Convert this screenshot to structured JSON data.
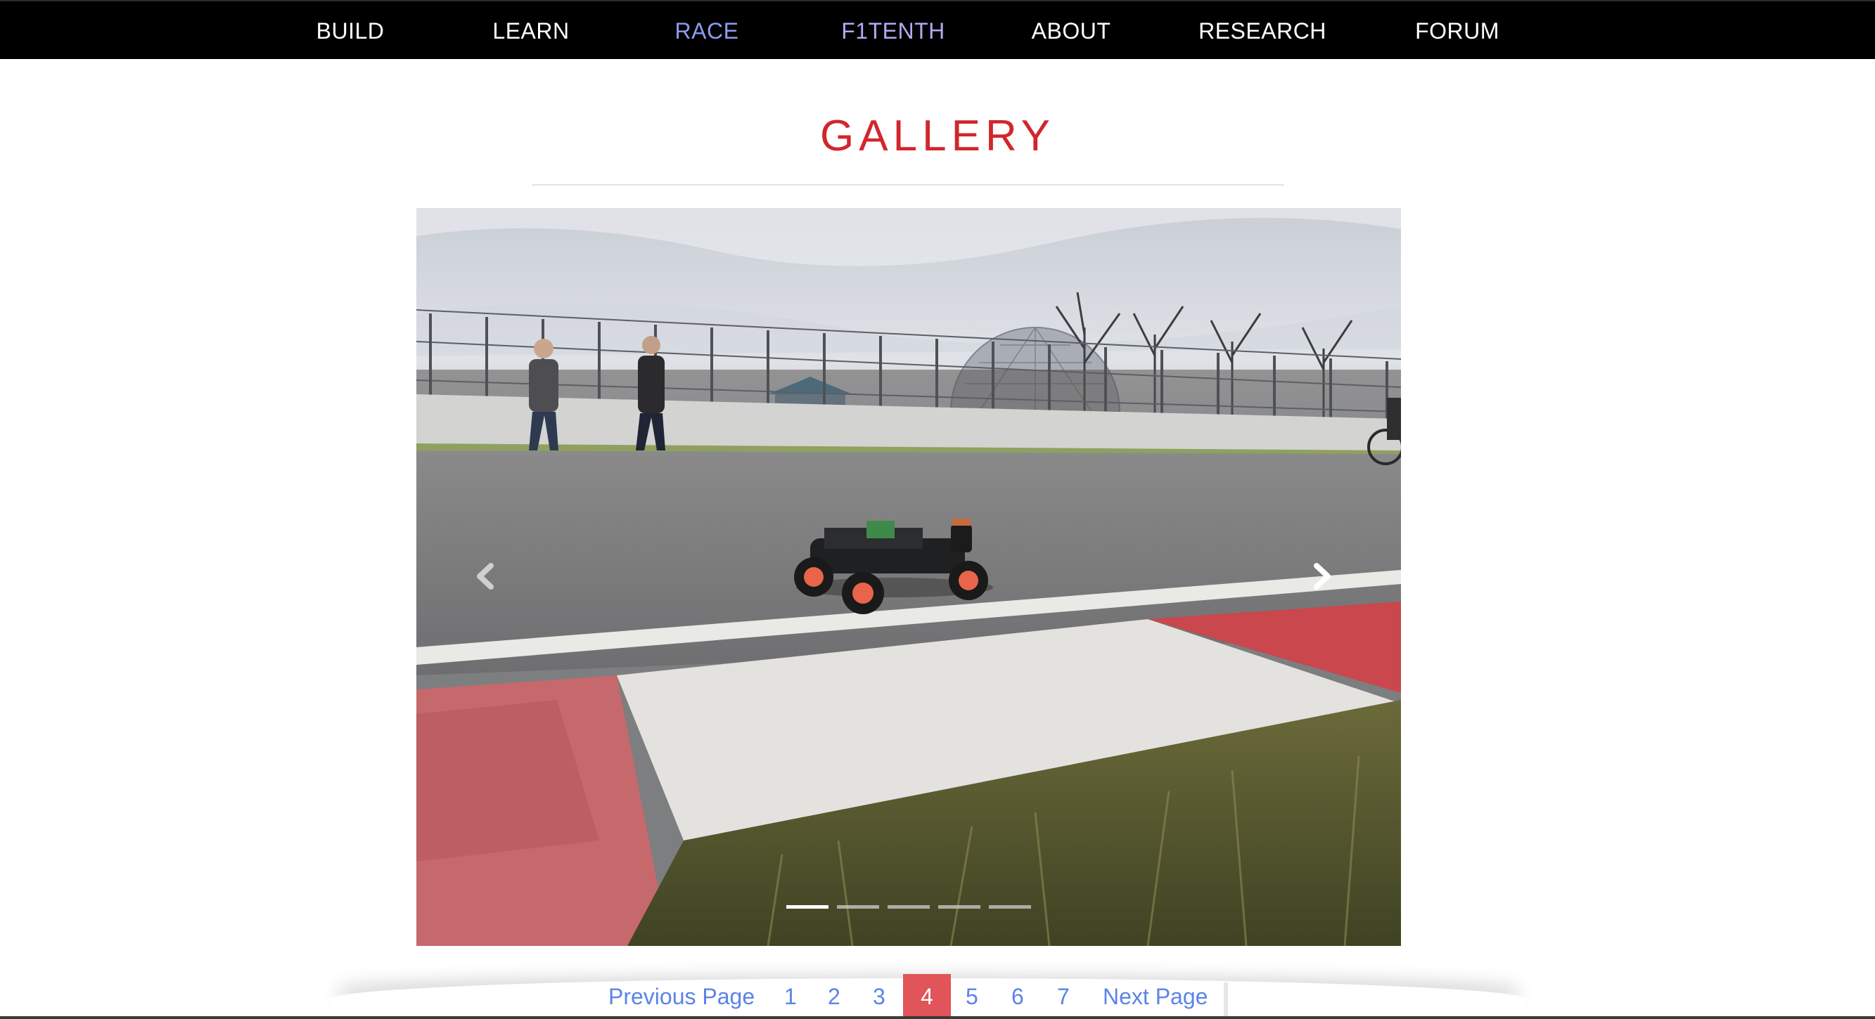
{
  "nav": {
    "items": [
      {
        "label": "BUILD"
      },
      {
        "label": "LEARN"
      },
      {
        "label": "RACE"
      },
      {
        "label": "F1TENTH"
      },
      {
        "label": "ABOUT"
      },
      {
        "label": "RESEARCH"
      },
      {
        "label": "FORUM"
      }
    ]
  },
  "gallery": {
    "title": "GALLERY",
    "slide_count": 5,
    "active_slide": 1
  },
  "pagination": {
    "previous_label": "Previous Page",
    "next_label": "Next Page",
    "pages": [
      "1",
      "2",
      "3",
      "4",
      "5",
      "6",
      "7"
    ],
    "current_page": "4"
  },
  "colors": {
    "nav_bg": "#000000",
    "title": "#d2262d",
    "link": "#5b84e8",
    "current_page_bg": "#e0545a",
    "race_link": "#8b9cf0",
    "f1tenth_link": "#b7a6f2"
  },
  "icons": {
    "prev": "chevron-left-icon",
    "next": "chevron-right-icon"
  }
}
